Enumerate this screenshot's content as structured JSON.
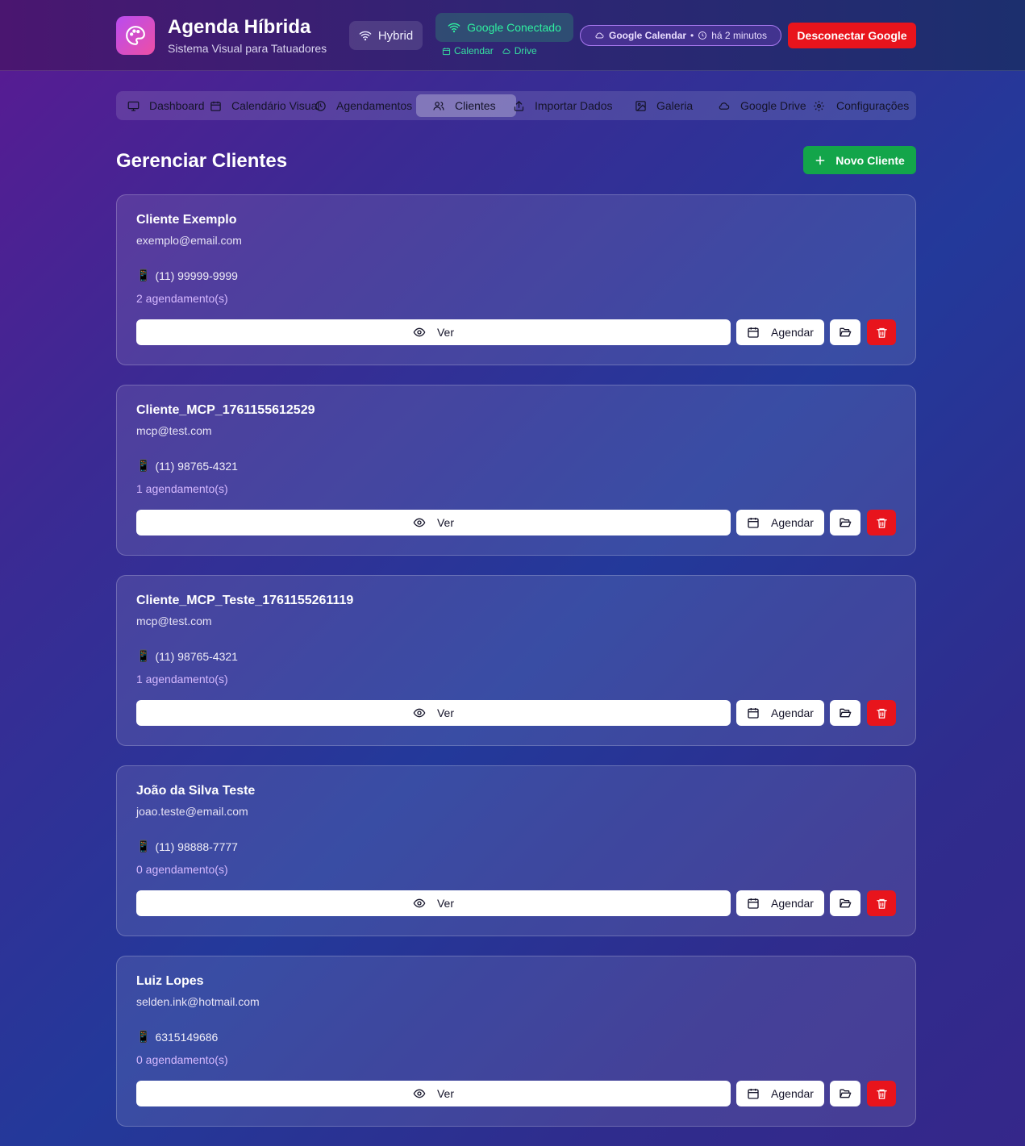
{
  "header": {
    "title": "Agenda Híbrida",
    "subtitle": "Sistema Visual para Tatuadores",
    "mode_label": "Hybrid",
    "connection_label": "Google Conectado",
    "calendar_link": "Calendar",
    "drive_link": "Drive",
    "sync_service": "Google Calendar",
    "sync_separator": "•",
    "sync_time": "há 2 minutos",
    "disconnect_label": "Desconectar Google",
    "logo_icon": "palette-icon"
  },
  "nav": {
    "tabs": [
      {
        "label": "Dashboard",
        "icon": "monitor-icon"
      },
      {
        "label": "Calendário Visual",
        "icon": "calendar-icon"
      },
      {
        "label": "Agendamentos",
        "icon": "clock-icon"
      },
      {
        "label": "Clientes",
        "icon": "users-icon"
      },
      {
        "label": "Importar Dados",
        "icon": "upload-icon"
      },
      {
        "label": "Galeria",
        "icon": "image-icon"
      },
      {
        "label": "Google Drive",
        "icon": "cloud-icon"
      },
      {
        "label": "Configurações",
        "icon": "gear-icon"
      }
    ],
    "active": "Clientes"
  },
  "main": {
    "title": "Gerenciar Clientes",
    "new_button_label": "Novo Cliente",
    "phone_icon": "📱",
    "view_label": "Ver",
    "schedule_label": "Agendar",
    "clients": [
      {
        "name": "Cliente Exemplo",
        "email": "exemplo@email.com",
        "phone": "(11) 99999-9999",
        "appointments": "2 agendamento(s)"
      },
      {
        "name": "Cliente_MCP_1761155612529",
        "email": "mcp@test.com",
        "phone": "(11) 98765-4321",
        "appointments": "1 agendamento(s)"
      },
      {
        "name": "Cliente_MCP_Teste_1761155261119",
        "email": "mcp@test.com",
        "phone": "(11) 98765-4321",
        "appointments": "1 agendamento(s)"
      },
      {
        "name": "João da Silva Teste",
        "email": "joao.teste@email.com",
        "phone": "(11) 98888-7777",
        "appointments": "0 agendamento(s)"
      },
      {
        "name": "Luiz Lopes",
        "email": "selden.ink@hotmail.com",
        "phone": "6315149686",
        "appointments": "0 agendamento(s)"
      }
    ]
  },
  "colors": {
    "accent_green": "#13a54a",
    "danger_red": "#e8141c",
    "connected_green": "#2ff0a0",
    "appointments_purple": "#d6b9ff"
  }
}
